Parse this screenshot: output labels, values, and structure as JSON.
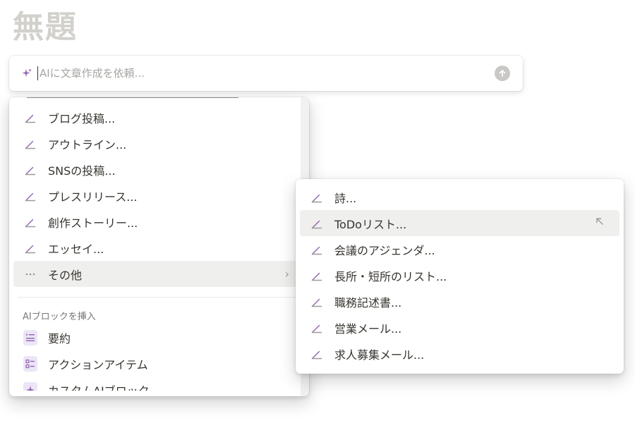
{
  "page": {
    "title": "無題"
  },
  "ai_bar": {
    "placeholder": "AIに文章作成を依頼..."
  },
  "main_menu": {
    "items": [
      {
        "label": "ブログ投稿...",
        "icon": "pen-icon"
      },
      {
        "label": "アウトライン...",
        "icon": "pen-icon"
      },
      {
        "label": "SNSの投稿...",
        "icon": "pen-icon"
      },
      {
        "label": "プレスリリース...",
        "icon": "pen-icon"
      },
      {
        "label": "創作ストーリー...",
        "icon": "pen-icon"
      },
      {
        "label": "エッセイ...",
        "icon": "pen-icon"
      }
    ],
    "more": {
      "label": "その他",
      "icon": "ellipsis-icon",
      "chevron": "›"
    },
    "section_label": "AIブロックを挿入",
    "blocks": [
      {
        "label": "要約",
        "icon": "summary-block-icon"
      },
      {
        "label": "アクションアイテム",
        "icon": "checklist-block-icon"
      },
      {
        "label": "カスタムAIブロック",
        "icon": "custom-ai-block-icon"
      }
    ]
  },
  "sub_menu": {
    "items": [
      {
        "label": "詩...",
        "icon": "pen-icon"
      },
      {
        "label": "ToDoリスト...",
        "icon": "pen-icon"
      },
      {
        "label": "会議のアジェンダ...",
        "icon": "pen-icon"
      },
      {
        "label": "長所・短所のリスト...",
        "icon": "pen-icon"
      },
      {
        "label": "職務記述書...",
        "icon": "pen-icon"
      },
      {
        "label": "営業メール...",
        "icon": "pen-icon"
      },
      {
        "label": "求人募集メール...",
        "icon": "pen-icon"
      }
    ]
  },
  "colors": {
    "accent_purple": "#9065b0",
    "hover_bg": "#efefed",
    "text": "#37352f",
    "muted": "#787774"
  }
}
